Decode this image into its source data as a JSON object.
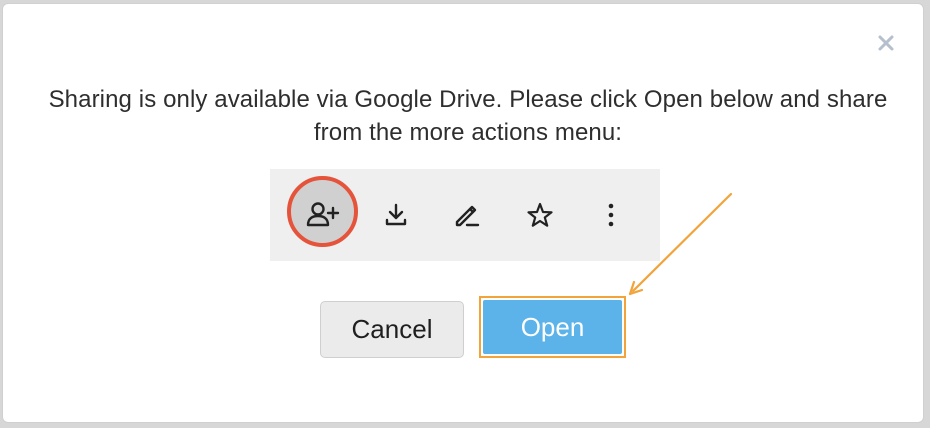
{
  "dialog": {
    "message": "Sharing is only available via Google Drive. Please click Open below and share from the more actions menu:",
    "close_icon": "close-icon",
    "toolbar": {
      "items": [
        {
          "icon": "add-person-icon",
          "highlighted": true
        },
        {
          "icon": "download-icon"
        },
        {
          "icon": "rename-icon"
        },
        {
          "icon": "star-icon"
        },
        {
          "icon": "more-vert-icon"
        }
      ]
    },
    "buttons": {
      "cancel_label": "Cancel",
      "open_label": "Open"
    }
  },
  "colors": {
    "highlight_ring": "#e5533b",
    "annotation_arrow": "#f2a33a",
    "open_button": "#5bb3ea",
    "toolbar_bg": "#efefef"
  }
}
